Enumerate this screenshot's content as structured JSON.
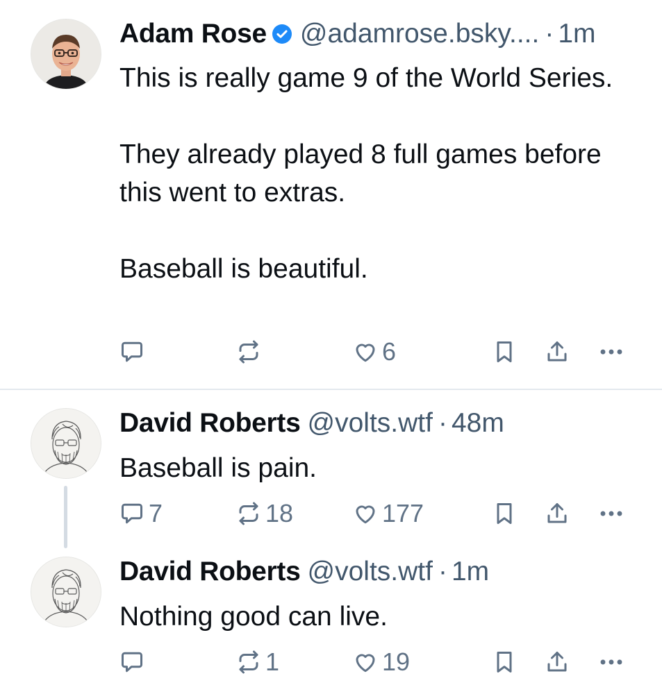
{
  "posts": [
    {
      "author": "Adam Rose",
      "verified": true,
      "handle": "@adamrose.bsky....",
      "separator": "·",
      "time": "1m",
      "paragraphs": [
        "This is really game 9 of the World Series.",
        "They already played 8 full games before this went to extras.",
        "Baseball is beautiful."
      ],
      "counts": {
        "reply": "",
        "repost": "",
        "like": "6"
      }
    },
    {
      "author": "David Roberts",
      "verified": false,
      "handle": "@volts.wtf",
      "separator": "·",
      "time": "48m",
      "paragraphs": [
        "Baseball is pain."
      ],
      "counts": {
        "reply": "7",
        "repost": "18",
        "like": "177"
      }
    },
    {
      "author": "David Roberts",
      "verified": false,
      "handle": "@volts.wtf",
      "separator": "·",
      "time": "1m",
      "paragraphs": [
        "Nothing good can live."
      ],
      "counts": {
        "reply": "",
        "repost": "1",
        "like": "19"
      }
    }
  ],
  "icons": {
    "reply": "reply-icon",
    "repost": "repost-icon",
    "like": "like-icon",
    "bookmark": "bookmark-icon",
    "share": "share-icon",
    "more": "more-icon",
    "verified": "verified-badge-icon"
  },
  "colors": {
    "text": "#0b0f14",
    "secondary": "#42576c",
    "action": "#607286",
    "verified": "#1d8af8",
    "divider": "#e3e8ee"
  }
}
